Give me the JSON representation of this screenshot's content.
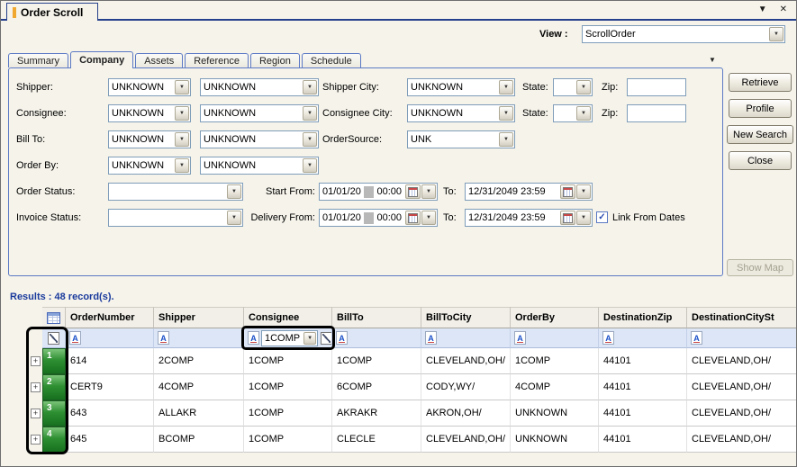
{
  "icons": {
    "minimize": "▼",
    "close": "✕",
    "dropdown": "▼",
    "overflow": "▼",
    "expand": "+",
    "check": "✓",
    "filter": "A"
  },
  "titlebar": {
    "title": "Order Scroll"
  },
  "view": {
    "label": "View :",
    "value": "ScrollOrder"
  },
  "tabs": [
    {
      "label": "Summary"
    },
    {
      "label": "Company"
    },
    {
      "label": "Assets"
    },
    {
      "label": "Reference"
    },
    {
      "label": "Region"
    },
    {
      "label": "Schedule"
    }
  ],
  "form": {
    "company_rows": [
      {
        "label": "Shipper:",
        "combo1": "UNKNOWN",
        "combo2": "UNKNOWN"
      },
      {
        "label": "Consignee:",
        "combo1": "UNKNOWN",
        "combo2": "UNKNOWN"
      },
      {
        "label": "Bill To:",
        "combo1": "UNKNOWN",
        "combo2": "UNKNOWN"
      },
      {
        "label": "Order By:",
        "combo1": "UNKNOWN",
        "combo2": "UNKNOWN"
      }
    ],
    "shipper_city": {
      "label": "Shipper City:",
      "value": "UNKNOWN",
      "state_label": "State:",
      "zip_label": "Zip:"
    },
    "consignee_city": {
      "label": "Consignee City:",
      "value": "UNKNOWN",
      "state_label": "State:",
      "zip_label": "Zip:"
    },
    "order_source": {
      "label": "OrderSource:",
      "value": "UNK"
    },
    "status_rows": [
      {
        "label": "Order Status:",
        "from_label": "Start From:",
        "from_date": "01/01/20",
        "from_time": "00:00",
        "to_label": "To:",
        "to_value": "12/31/2049 23:59"
      },
      {
        "label": "Invoice Status:",
        "from_label": "Delivery From:",
        "from_date": "01/01/20",
        "from_time": "00:00",
        "to_label": "To:",
        "to_value": "12/31/2049 23:59"
      }
    ],
    "link_from_dates": "Link From Dates"
  },
  "actions": {
    "retrieve": "Retrieve",
    "profile": "Profile",
    "new_search": "New Search",
    "close": "Close",
    "show_map": "Show Map"
  },
  "results": {
    "summary": "Results : 48 record(s).",
    "columns": [
      "OrderNumber",
      "Shipper",
      "Consignee",
      "BillTo",
      "BillToCity",
      "OrderBy",
      "DestinationZip",
      "DestinationCitySt"
    ],
    "filter": {
      "consignee_value": "1COMP"
    },
    "rows": [
      {
        "num": "1",
        "cells": [
          "614",
          "2COMP",
          "1COMP",
          "1COMP",
          "CLEVELAND,OH/",
          "1COMP",
          "44101",
          "CLEVELAND,OH/"
        ]
      },
      {
        "num": "2",
        "cells": [
          "CERT9",
          "4COMP",
          "1COMP",
          "6COMP",
          "CODY,WY/",
          "4COMP",
          "44101",
          "CLEVELAND,OH/"
        ]
      },
      {
        "num": "3",
        "cells": [
          "643",
          "ALLAKR",
          "1COMP",
          "AKRAKR",
          "AKRON,OH/",
          "UNKNOWN",
          "44101",
          "CLEVELAND,OH/"
        ]
      },
      {
        "num": "4",
        "cells": [
          "645",
          "BCOMP",
          "1COMP",
          "CLECLE",
          "CLEVELAND,OH/",
          "UNKNOWN",
          "44101",
          "CLEVELAND,OH/"
        ]
      }
    ]
  }
}
